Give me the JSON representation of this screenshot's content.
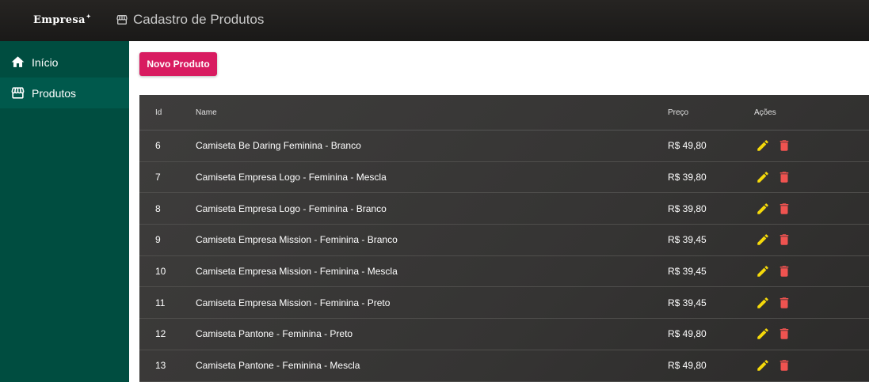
{
  "header": {
    "logo_text": "Empresa",
    "logo_mark": "✦",
    "page_title": "Cadastro de Produtos",
    "title_icon": "storefront-icon"
  },
  "sidebar": {
    "items": [
      {
        "label": "Início",
        "icon": "home-icon",
        "active": false
      },
      {
        "label": "Produtos",
        "icon": "storefront-icon",
        "active": true
      }
    ]
  },
  "toolbar": {
    "new_button_label": "Novo Produto"
  },
  "table": {
    "columns": [
      "Id",
      "Name",
      "Preço",
      "Ações"
    ],
    "rows": [
      {
        "id": "6",
        "name": "Camiseta Be Daring Feminina - Branco",
        "price": "R$ 49,80"
      },
      {
        "id": "7",
        "name": "Camiseta Empresa Logo - Feminina - Mescla",
        "price": "R$ 39,80"
      },
      {
        "id": "8",
        "name": "Camiseta Empresa Logo - Feminina - Branco",
        "price": "R$ 39,80"
      },
      {
        "id": "9",
        "name": "Camiseta Empresa Mission - Feminina - Branco",
        "price": "R$ 39,45"
      },
      {
        "id": "10",
        "name": "Camiseta Empresa Mission - Feminina - Mescla",
        "price": "R$ 39,45"
      },
      {
        "id": "11",
        "name": "Camiseta Empresa Mission - Feminina - Preto",
        "price": "R$ 39,45"
      },
      {
        "id": "12",
        "name": "Camiseta Pantone - Feminina - Preto",
        "price": "R$ 49,80"
      },
      {
        "id": "13",
        "name": "Camiseta Pantone - Feminina - Mescla",
        "price": "R$ 49,80"
      }
    ],
    "action_icons": [
      "pencil-icon",
      "trash-icon"
    ]
  },
  "colors": {
    "topbar": "#1f1e1d",
    "sidebar": "#004d40",
    "sidebar_active": "#00594c",
    "primary_button": "#d81b60",
    "edit_icon": "#f5d90a",
    "delete_icon": "#ef5350"
  }
}
